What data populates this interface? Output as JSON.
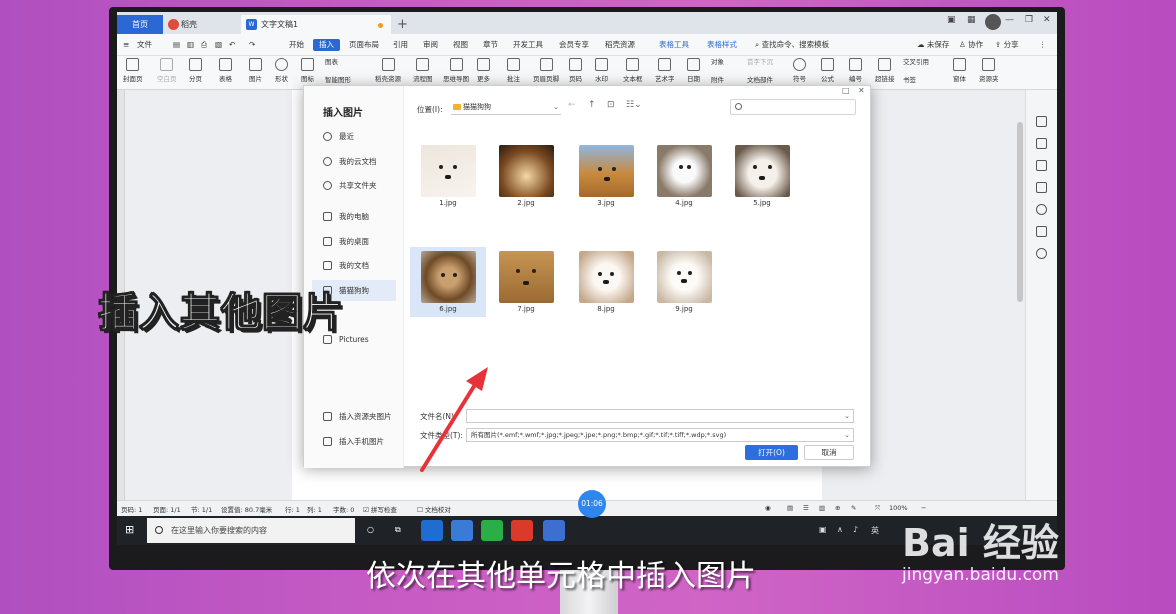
{
  "tabs": {
    "home": "首页",
    "daoke": "稻壳",
    "doc": "文字文稿1",
    "plus": "+"
  },
  "menubar": {
    "file": "文件",
    "items": [
      "开始",
      "插入",
      "页面布局",
      "引用",
      "审阅",
      "视图",
      "章节",
      "开发工具",
      "会员专享",
      "稻壳资源"
    ],
    "tools": [
      "表格工具",
      "表格样式"
    ],
    "search": "查找命令、搜索模板",
    "unsaved": "未保存",
    "collab": "协作",
    "share": "分享"
  },
  "ribbon": [
    "封面页",
    "空白页",
    "分页",
    "表格",
    "图片",
    "形状",
    "图标",
    "智能图形",
    "稻壳资源",
    "流程图",
    "思维导图",
    "更多",
    "批注",
    "页眉页脚",
    "页码",
    "水印",
    "文本框",
    "艺术字",
    "日期",
    "附件",
    "文档部件",
    "符号",
    "公式",
    "编号",
    "超链接",
    "书签",
    "窗体",
    "资源夹",
    "对象",
    "首字下沉",
    "交叉引用",
    "图表"
  ],
  "dialog": {
    "title": "插入图片",
    "location_label": "位置(I):",
    "location_value": "猫猫狗狗",
    "nav": [
      "最近",
      "我的云文档",
      "共享文件夹",
      "我的电脑",
      "我的桌面",
      "我的文档",
      "猫猫狗狗",
      "Pictures"
    ],
    "bottom_nav": [
      "插入资源夹图片",
      "插入手机图片"
    ],
    "files": [
      "1.jpg",
      "2.jpg",
      "3.jpg",
      "4.jpg",
      "5.jpg",
      "6.jpg",
      "7.jpg",
      "8.jpg",
      "9.jpg"
    ],
    "filename_label": "文件名(N):",
    "filename_value": "",
    "filetype_label": "文件类型(T):",
    "filetype_value": "所有图片(*.emf;*.wmf;*.jpg;*.jpeg;*.jpe;*.png;*.bmp;*.gif;*.tif;*.tiff;*.wdp;*.svg)",
    "open": "打开(O)",
    "cancel": "取消"
  },
  "status": {
    "page": "页码: 1",
    "pages": "页面: 1/1",
    "section": "节: 1/1",
    "setting": "设置值: 80.7毫米",
    "row": "行: 1",
    "col": "列: 1",
    "words": "字数: 0",
    "spell": "拼写检查",
    "proofread": "文档校对",
    "zoom": "100%"
  },
  "taskbar": {
    "search": "在这里输入你要搜索的内容",
    "ime": "英"
  },
  "overlay": {
    "caption": "插入其他图片",
    "subtitle": "依次在其他单元格中插入图片",
    "timer": "01:06",
    "watermark1": "Bai 经验",
    "watermark2": "jingyan.baidu.com"
  },
  "colors": {
    "accent": "#2c68d4",
    "annotation_arrow": "#e8323a"
  }
}
